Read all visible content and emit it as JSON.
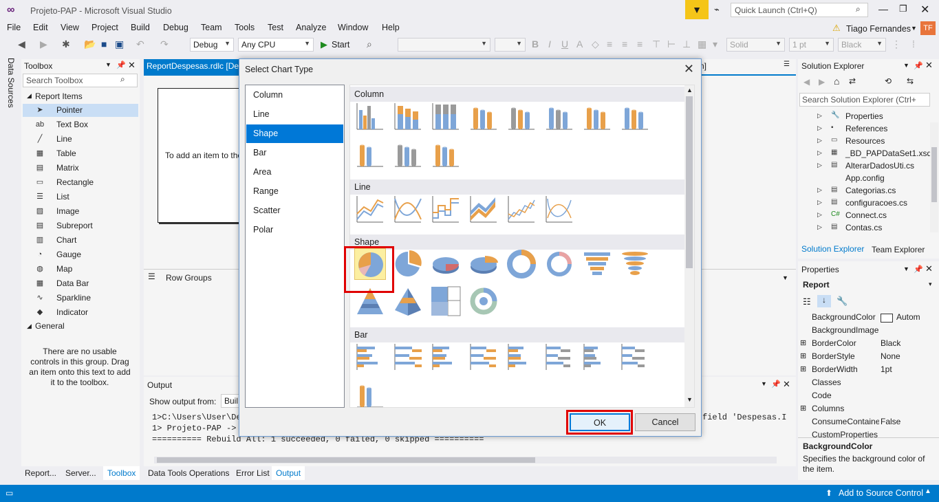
{
  "title_bar": {
    "title": "Projeto-PAP - Microsoft Visual Studio",
    "quick_launch_placeholder": "Quick Launch (Ctrl+Q)",
    "user_initials": "TF"
  },
  "menu": [
    "File",
    "Edit",
    "View",
    "Project",
    "Build",
    "Debug",
    "Team",
    "Tools",
    "Test",
    "Analyze",
    "Window",
    "Help"
  ],
  "user_name": "Tiago Fernandes",
  "toolbar": {
    "config": "Debug",
    "platform": "Any CPU",
    "start_label": "Start",
    "border_style": "Solid",
    "border_width": "1 pt",
    "color": "Black"
  },
  "left_vertical_tab": "Data Sources",
  "toolbox": {
    "title": "Toolbox",
    "search_placeholder": "Search Toolbox",
    "group_report_items": "Report Items",
    "items": [
      "Pointer",
      "Text Box",
      "Line",
      "Table",
      "Matrix",
      "Rectangle",
      "List",
      "Image",
      "Subreport",
      "Chart",
      "Gauge",
      "Map",
      "Data Bar",
      "Sparkline",
      "Indicator"
    ],
    "group_general": "General",
    "general_empty_text": "There are no usable controls in this group. Drag an item onto this text to add it to the toolbox."
  },
  "document": {
    "tab_label": "ReportDespesas.rdlc [Des",
    "tab_suffix": "n]",
    "canvas_hint": "To add an item to the",
    "row_groups": "Row Groups"
  },
  "output": {
    "title": "Output",
    "show_from_label": "Show output from:",
    "source": "Buil",
    "lines": [
      "1>C:\\Users\\User\\De",
      "1>  Projeto-PAP ->",
      "========== Rebuild All: 1 succeeded, 0 failed, 0 skipped =========="
    ],
    "right_fragment": "field 'Despesas.I"
  },
  "bottom_tabs_left": [
    "Report...",
    "Server...",
    "Toolbox"
  ],
  "bottom_tabs_mid": [
    "Data Tools Operations",
    "Error List",
    "Output"
  ],
  "solution_explorer": {
    "title": "Solution Explorer",
    "search_placeholder": "Search Solution Explorer (Ctrl+",
    "items": [
      "Properties",
      "References",
      "Resources",
      "_BD_PAPDataSet1.xsd",
      "AlterarDadosUti.cs",
      "App.config",
      "Categorias.cs",
      "configuracoes.cs",
      "Connect.cs",
      "Contas.cs"
    ],
    "tabs": [
      "Solution Explorer",
      "Team Explorer"
    ]
  },
  "properties": {
    "title": "Properties",
    "object": "Report",
    "rows": [
      {
        "name": "BackgroundColor",
        "value": "Autom"
      },
      {
        "name": "BackgroundImage",
        "value": ""
      },
      {
        "name": "BorderColor",
        "value": "Black"
      },
      {
        "name": "BorderStyle",
        "value": "None"
      },
      {
        "name": "BorderWidth",
        "value": "1pt"
      },
      {
        "name": "Classes",
        "value": ""
      },
      {
        "name": "Code",
        "value": ""
      },
      {
        "name": "Columns",
        "value": ""
      },
      {
        "name": "ConsumeContainer",
        "value": "False"
      },
      {
        "name": "CustomProperties",
        "value": ""
      }
    ],
    "desc_title": "BackgroundColor",
    "desc_text": "Specifies the background color of the item."
  },
  "status": {
    "right": "Add to Source Control"
  },
  "dialog": {
    "title": "Select Chart Type",
    "categories": [
      "Column",
      "Line",
      "Shape",
      "Bar",
      "Area",
      "Range",
      "Scatter",
      "Polar"
    ],
    "selected_category": "Shape",
    "sections": [
      "Column",
      "Line",
      "Shape",
      "Bar"
    ],
    "ok_label": "OK",
    "cancel_label": "Cancel"
  },
  "colors": {
    "accent": "#0078d7",
    "status": "#007acc",
    "blue_series": "#7ea6d8",
    "orange_series": "#e8a04a",
    "gray_series": "#9a9a9a",
    "highlight": "#e00000"
  }
}
